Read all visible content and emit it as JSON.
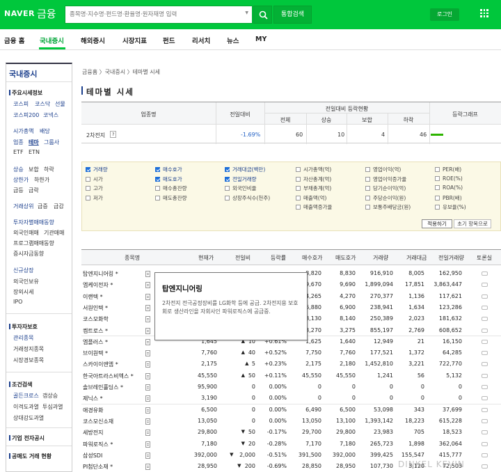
{
  "header": {
    "logo": "NAVER",
    "logo_sub": "금융",
    "search_placeholder": "종목명·지수명·펀드명·환율명·원자재명 입력",
    "search_button": "search-icon",
    "integrated_search": "통합검색",
    "login": "로그인",
    "brand_color": "#00c73c"
  },
  "nav": {
    "items": [
      "금융 홈",
      "국내증시",
      "해외증시",
      "시장지표",
      "펀드",
      "리서치",
      "뉴스",
      "MY"
    ],
    "active": "국내증시"
  },
  "sidebar": {
    "title": "국내증시",
    "sections": {
      "main_index": "주요시세정보",
      "row1": [
        "코스피",
        "코스닥",
        "선물"
      ],
      "row2": [
        "코스피200",
        "코넥스"
      ],
      "row3": [
        "시가총액",
        "배당"
      ],
      "row4": [
        "업종",
        "테마",
        "그룹사"
      ],
      "row5": [
        "ETF",
        "ETN"
      ],
      "row6": [
        "상승",
        "보합",
        "하락"
      ],
      "row7": [
        "상한가",
        "하한가"
      ],
      "row8": [
        "급등",
        "급락"
      ],
      "row9": [
        "거래상위",
        "급증",
        "급감"
      ],
      "investor_head": "투자자별매매동향",
      "investor_items": [
        "외국인매매",
        "기관매매",
        "프로그램매매동향",
        "증시자금동향"
      ],
      "new_head": "신규상장",
      "new_items": [
        "외국인보유",
        "장외시세",
        "IPO"
      ],
      "invest_info_head": "투자자보호",
      "invest_info_items": [
        "관리종목",
        "거래정지종목",
        "시장경보종목"
      ],
      "search_head": "조건검색",
      "search_items_r1": [
        "골든크로스",
        "갭상승"
      ],
      "search_items_r2": [
        "이격도과열",
        "투심과열"
      ],
      "search_items_r3": [
        "상대강도과열"
      ],
      "ir": "기업 전자공시",
      "short": "공매도 거래 현황"
    }
  },
  "breadcrumb": "금융홈 〉국내증시 〉테마별 시세",
  "page_title": "테마별 시세",
  "summary": {
    "headers": {
      "name": "업종명",
      "prev_ratio": "전일대비",
      "group": "전일대비 등락현황",
      "all": "전체",
      "up": "상승",
      "flat": "보합",
      "down": "하락",
      "graph": "등락그래프"
    },
    "row": {
      "name": "2차전지",
      "help": "?",
      "ratio": "-1.69%",
      "all": "60",
      "up": "10",
      "flat": "4",
      "down": "46"
    }
  },
  "options": {
    "col1": [
      {
        "label": "거래량",
        "on": true
      },
      {
        "label": "시가",
        "on": false
      },
      {
        "label": "고가",
        "on": false
      },
      {
        "label": "저가",
        "on": false
      }
    ],
    "col2": [
      {
        "label": "매수호가",
        "on": true
      },
      {
        "label": "매도호가",
        "on": true
      },
      {
        "label": "매수총잔량",
        "on": false
      },
      {
        "label": "매도총잔량",
        "on": false
      }
    ],
    "col3": [
      {
        "label": "거래대금(백만)",
        "on": true
      },
      {
        "label": "전일거래량",
        "on": true
      },
      {
        "label": "외국인비율",
        "on": false
      },
      {
        "label": "상장주식수(천주)",
        "on": false
      }
    ],
    "col4": [
      {
        "label": "시가총액(억)",
        "on": false
      },
      {
        "label": "자산총계(억)",
        "on": false
      },
      {
        "label": "부채총계(억)",
        "on": false
      },
      {
        "label": "매출액(억)",
        "on": false
      },
      {
        "label": "매출액증가율",
        "on": false
      }
    ],
    "col5": [
      {
        "label": "영업이익(억)",
        "on": false
      },
      {
        "label": "영업이익증가율",
        "on": false
      },
      {
        "label": "당기순이익(억)",
        "on": false
      },
      {
        "label": "주당순이익(원)",
        "on": false
      },
      {
        "label": "보통주배당금(원)",
        "on": false
      }
    ],
    "col6": [
      {
        "label": "PER(배)",
        "on": false
      },
      {
        "label": "ROE(%)",
        "on": false
      },
      {
        "label": "ROA(%)",
        "on": false
      },
      {
        "label": "PBR(배)",
        "on": false
      },
      {
        "label": "유보율(%)",
        "on": false
      }
    ],
    "apply": "적용하기",
    "reset": "초기 항목으로"
  },
  "table": {
    "headers": [
      "종목명",
      "현재가",
      "전일비",
      "등락률",
      "매수호가",
      "매도호가",
      "거래량",
      "거래대금",
      "전일거래량",
      "토론실"
    ],
    "rows": [
      {
        "name": "탑엔지니어링 *",
        "price": "",
        "chg": "",
        "dir": "",
        "rate": "",
        "bid": "8,820",
        "ask": "8,830",
        "vol": "916,910",
        "amt": "8,005",
        "pvol": "162,950"
      },
      {
        "name": "엠케이전자 *",
        "price": "",
        "chg": "",
        "dir": "",
        "rate": "",
        "bid": "9,670",
        "ask": "9,690",
        "vol": "1,899,094",
        "amt": "17,851",
        "pvol": "3,863,447"
      },
      {
        "name": "이랜텍 *",
        "price": "",
        "chg": "",
        "dir": "",
        "rate": "",
        "bid": "4,265",
        "ask": "4,270",
        "vol": "270,377",
        "amt": "1,136",
        "pvol": "117,621"
      },
      {
        "name": "서원인텍 *",
        "price": "",
        "chg": "",
        "dir": "",
        "rate": "",
        "bid": "6,880",
        "ask": "6,900",
        "vol": "238,941",
        "amt": "1,634",
        "pvol": "123,286"
      },
      {
        "name": "코스모화학",
        "price": "",
        "chg": "",
        "dir": "",
        "rate": "",
        "bid": "8,130",
        "ask": "8,140",
        "vol": "250,389",
        "amt": "2,023",
        "pvol": "181,632"
      },
      {
        "name": "켐트로스 *",
        "price": "",
        "chg": "",
        "dir": "",
        "rate": "",
        "bid": "3,270",
        "ask": "3,275",
        "vol": "855,197",
        "amt": "2,769",
        "pvol": "608,652"
      },
      {
        "name": "엠플러스 *",
        "price": "1,645",
        "chg": "10",
        "dir": "up",
        "rate": "+0.61%",
        "bid": "1,625",
        "ask": "1,640",
        "vol": "12,949",
        "amt": "21",
        "pvol": "16,150"
      },
      {
        "name": "브이원텍 *",
        "price": "7,760",
        "chg": "40",
        "dir": "up",
        "rate": "+0.52%",
        "bid": "7,750",
        "ask": "7,760",
        "vol": "177,521",
        "amt": "1,372",
        "pvol": "64,285"
      },
      {
        "name": "스카이이앤엠 *",
        "price": "2,175",
        "chg": "5",
        "dir": "up",
        "rate": "+0.23%",
        "bid": "2,175",
        "ask": "2,180",
        "vol": "1,452,810",
        "amt": "3,221",
        "pvol": "722,770"
      },
      {
        "name": "한국아트라스비엑스 *",
        "price": "45,550",
        "chg": "50",
        "dir": "up",
        "rate": "+0.11%",
        "bid": "45,550",
        "ask": "45,550",
        "vol": "1,241",
        "amt": "56",
        "pvol": "5,132"
      },
      {
        "name": "솔브레인홀딩스 *",
        "price": "95,900",
        "chg": "0",
        "dir": "",
        "rate": "0.00%",
        "bid": "0",
        "ask": "0",
        "vol": "0",
        "amt": "0",
        "pvol": "0"
      },
      {
        "name": "제닉스 *",
        "price": "3,190",
        "chg": "0",
        "dir": "",
        "rate": "0.00%",
        "bid": "0",
        "ask": "0",
        "vol": "0",
        "amt": "0",
        "pvol": "0"
      },
      {
        "name": "애경유화",
        "price": "6,500",
        "chg": "0",
        "dir": "",
        "rate": "0.00%",
        "bid": "6,490",
        "ask": "6,500",
        "vol": "53,098",
        "amt": "343",
        "pvol": "37,699"
      },
      {
        "name": "코스모신소재",
        "price": "13,050",
        "chg": "0",
        "dir": "",
        "rate": "0.00%",
        "bid": "13,050",
        "ask": "13,100",
        "vol": "1,393,142",
        "amt": "18,223",
        "pvol": "615,228"
      },
      {
        "name": "세방전지",
        "price": "29,800",
        "chg": "50",
        "dir": "dn",
        "rate": "-0.17%",
        "bid": "29,700",
        "ask": "29,800",
        "vol": "23,983",
        "amt": "705",
        "pvol": "18,523"
      },
      {
        "name": "파워로직스 *",
        "price": "7,180",
        "chg": "20",
        "dir": "dn",
        "rate": "-0.28%",
        "bid": "7,170",
        "ask": "7,180",
        "vol": "265,723",
        "amt": "1,898",
        "pvol": "362,064"
      },
      {
        "name": "삼성SDI",
        "price": "392,000",
        "chg": "2,000",
        "dir": "dn",
        "rate": "-0.51%",
        "bid": "391,500",
        "ask": "392,000",
        "vol": "399,425",
        "amt": "155,547",
        "pvol": "415,777"
      },
      {
        "name": "PI첨단소재 *",
        "price": "28,950",
        "chg": "200",
        "dir": "dn",
        "rate": "-0.69%",
        "bid": "28,850",
        "ask": "28,950",
        "vol": "107,730",
        "amt": "3,120",
        "pvol": "72,503"
      }
    ]
  },
  "tooltip": {
    "title": "탑엔지니어링",
    "body": "2차전지 전극공정장비를 LG화학 등에 공급. 2차전지용 보호회로 생산라인을 자회사인 파워로직스에 공급중."
  },
  "watermark": "DINKEL KEVIN",
  "colors": {
    "up": "#d0021b",
    "down": "#1f5fc4",
    "graph_bar": "#2db400"
  }
}
